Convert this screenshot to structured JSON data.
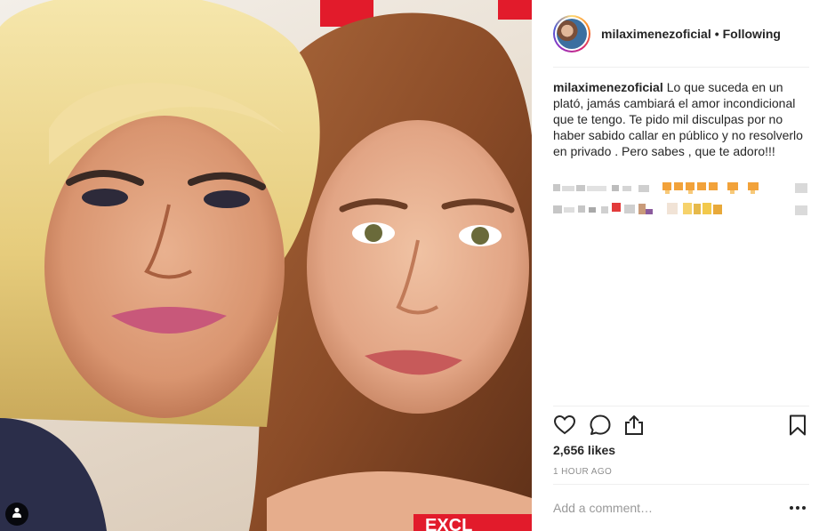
{
  "post": {
    "username": "milaximenezoficial",
    "separator": "•",
    "follow_status": "Following",
    "caption": "Lo que suceda en un plató, jamás cambiará el amor incondicional que te tengo. Te pido mil disculpas por no haber sabido callar en público y no resolverlo en privado . Pero sabes , que te adoro!!!",
    "likes": "2,656 likes",
    "timestamp": "1 HOUR AGO",
    "comment_placeholder": "Add a comment…"
  },
  "icons": {
    "like": "heart-icon",
    "comment": "comment-bubble-icon",
    "share": "share-icon",
    "save": "bookmark-icon",
    "more": "more-dots-icon",
    "tagged_user": "user-tag-icon"
  },
  "colors": {
    "text_primary": "#262626",
    "text_secondary": "#8e8e8e",
    "divider": "#efefef",
    "placeholder": "#999999"
  }
}
